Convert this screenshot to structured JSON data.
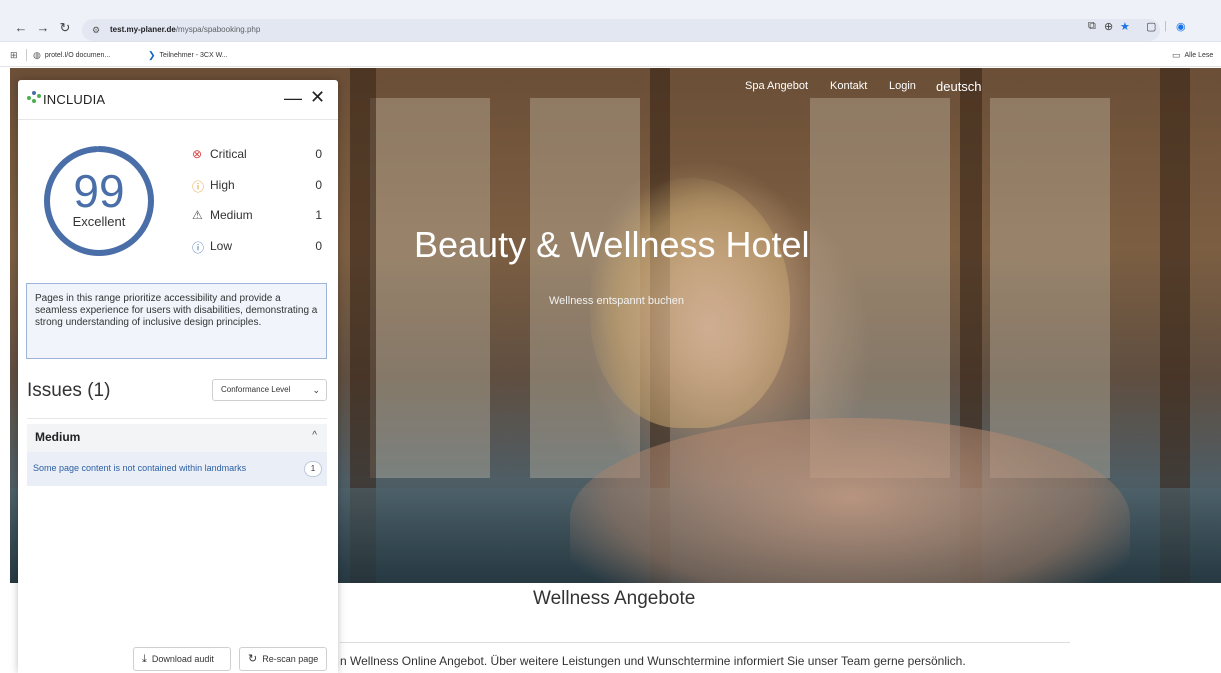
{
  "browser": {
    "url_host": "test.my-planer.de",
    "url_path": "/myspa/spabooking.php",
    "back_icon": "arrow-left-icon",
    "forward_icon": "arrow-right-icon",
    "reload_icon": "reload-icon",
    "bookmarks": [
      {
        "label": "protel.I/O documen...",
        "icon": "globe-icon"
      },
      {
        "label": "Teilnehmer - 3CX W...",
        "icon": "chevron-bookmark-icon"
      }
    ],
    "all_bookmarks_label": "Alle Lese"
  },
  "site": {
    "nav": [
      "Spa Angebot",
      "Kontakt",
      "Login"
    ],
    "language": "deutsch",
    "hero_title": "Beauty & Wellness Hotel",
    "hero_subtitle": "Wellness entspannt buchen",
    "section_title": "Wellness Angebote",
    "section_text": "n Wellness Online Angebot. Über weitere Leistungen und Wunschtermine informiert Sie unser Team gerne persönlich."
  },
  "panel": {
    "brand": "INCLUDIA",
    "minimize": "—",
    "close": "✕",
    "score": "99",
    "score_fraction": 0.99,
    "score_label": "Excellent",
    "severity": [
      {
        "label": "Critical",
        "count": "0",
        "icon": "x-circle-icon",
        "color": "#d64545"
      },
      {
        "label": "High",
        "count": "0",
        "icon": "warning-circle-icon",
        "color": "#e0962b"
      },
      {
        "label": "Medium",
        "count": "1",
        "icon": "warning-triangle-icon",
        "color": "#555555"
      },
      {
        "label": "Low",
        "count": "0",
        "icon": "info-circle-icon",
        "color": "#3f6fb5"
      }
    ],
    "info_text": "Pages in this range prioritize accessibility and provide a seamless experience for users with disabilities, demonstrating a strong understanding of inclusive design principles.",
    "issues_title": "Issues (1)",
    "conformance_label": "Conformance Level",
    "group_label": "Medium",
    "group_chevron": "^",
    "issue_text": "Some page content is not contained within landmarks",
    "issue_count": "1",
    "download_label": "Download audit",
    "rescan_label": "Re-scan page",
    "accent_color": "#4a6ea8"
  }
}
